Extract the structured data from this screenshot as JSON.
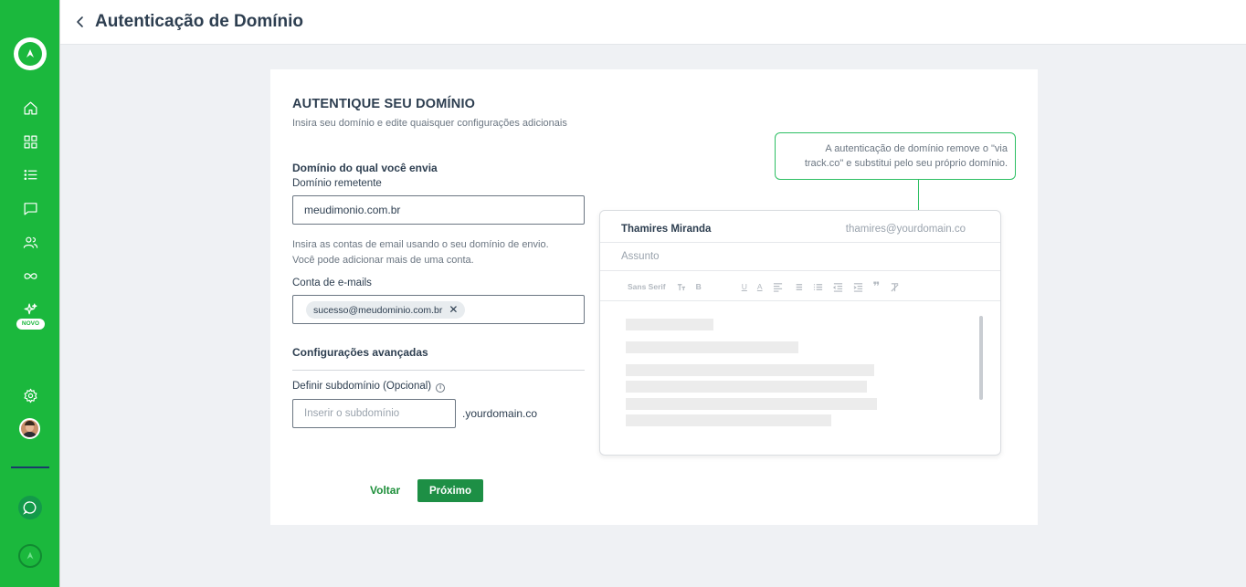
{
  "header": {
    "title": "Autenticação de Domínio"
  },
  "sidebar": {
    "novo_badge": "NOVO"
  },
  "card": {
    "title": "AUTENTIQUE SEU DOMÍNIO",
    "subtitle": "Insira seu domínio e edite quaisquer configurações adicionais",
    "section_sender": "Domínio do qual você envia",
    "label_sender_domain": "Domínio remetente",
    "sender_domain_value": "meudimonio.com.br",
    "help_line1": "Insira as contas de email usando o seu domínio de envio.",
    "help_line2": "Você pode adicionar mais de uma conta.",
    "label_email_accounts": "Conta de e-mails",
    "email_chip": "sucesso@meudominio.com.br",
    "section_advanced": "Configurações avançadas",
    "label_subdomain": "Definir subdomínio (Opcional)",
    "subdomain_placeholder": "Inserir o subdomínio",
    "domain_suffix": ".yourdomain.co",
    "back_button": "Voltar",
    "next_button": "Próximo"
  },
  "tooltip": {
    "line1": "A autenticação de domínio remove o \"via",
    "line2": "track.co\" e substitui pelo seu próprio domínio."
  },
  "preview": {
    "sender_name": "Thamires Miranda",
    "sender_email": "thamires@yourdomain.co",
    "subject_placeholder": "Assunto",
    "font_selector": "Sans Serif",
    "bold_label": "B",
    "underline_label": "U",
    "color_label": "A"
  },
  "colors": {
    "sidebar": "#1bb83d",
    "accent": "#1d8f45",
    "tooltip_border": "#2dbf63"
  }
}
